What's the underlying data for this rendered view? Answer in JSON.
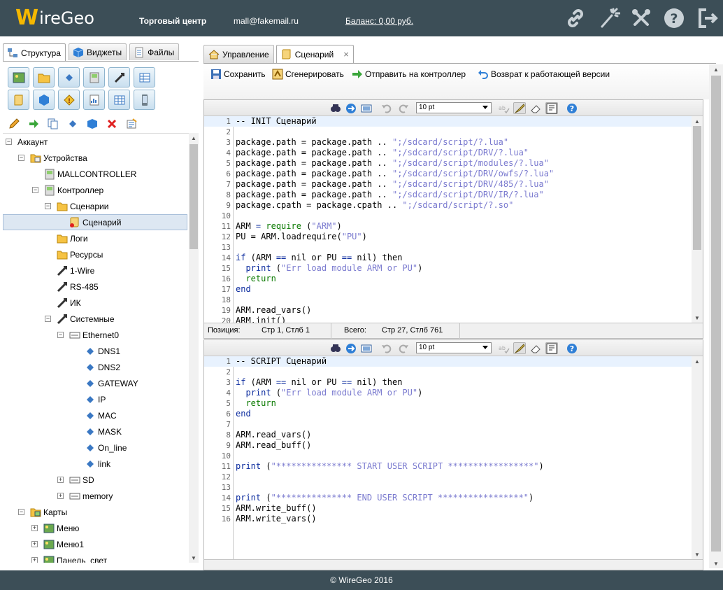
{
  "header": {
    "logo_w": "W",
    "logo_text": "ireGeo",
    "mall": "Торговый центр",
    "email": "mall@fakemail.ru",
    "balance": "Баланс: 0,00 руб.",
    "icons": [
      "link-icon",
      "magic-wand-icon",
      "tools-icon",
      "help-icon",
      "logout-icon"
    ]
  },
  "left_tabs": [
    {
      "label": "Структура",
      "icon": "structure-icon",
      "active": true
    },
    {
      "label": "Виджеты",
      "icon": "cube-icon",
      "active": false
    },
    {
      "label": "Файлы",
      "icon": "files-icon",
      "active": false
    }
  ],
  "tree": {
    "account": "Аккаунт",
    "devices": "Устройства",
    "mallcontroller": "MALLCONTROLLER",
    "controller": "Контроллер",
    "scenarios": "Сценарии",
    "scenario": "Сценарий",
    "logs": "Логи",
    "resources": "Ресурсы",
    "onewire": "1-Wire",
    "rs485": "RS-485",
    "ir": "ИК",
    "system": "Системные",
    "ethernet": "Ethernet0",
    "dns1": "DNS1",
    "dns2": "DNS2",
    "gateway": "GATEWAY",
    "ip": "IP",
    "mac": "MAC",
    "mask": "MASK",
    "online": "On_line",
    "link": "link",
    "sd": "SD",
    "memory": "memory",
    "maps": "Карты",
    "menu": "Меню",
    "menu1": "Меню1",
    "panel": "Панель_свет"
  },
  "right_tabs": [
    {
      "label": "Управление",
      "icon": "home-icon",
      "active": false
    },
    {
      "label": "Сценарий",
      "icon": "scroll-icon",
      "active": true,
      "close": "×"
    }
  ],
  "actions": {
    "save": "Сохранить",
    "generate": "Сгенерировать",
    "send": "Отправить на контроллер",
    "revert": "Возврат к работающей версии"
  },
  "font_size": "10 pt",
  "editor1": {
    "lines": [
      [
        [
          "c",
          "-- INIT Сценарий"
        ]
      ],
      [],
      [
        [
          "t",
          "package.path = package.path .. "
        ],
        [
          "s",
          "\";/sdcard/script/?.lua\""
        ]
      ],
      [
        [
          "t",
          "package.path = package.path .. "
        ],
        [
          "s",
          "\";/sdcard/script/DRV/?.lua\""
        ]
      ],
      [
        [
          "t",
          "package.path = package.path .. "
        ],
        [
          "s",
          "\";/sdcard/script/modules/?.lua\""
        ]
      ],
      [
        [
          "t",
          "package.path = package.path .. "
        ],
        [
          "s",
          "\";/sdcard/script/DRV/owfs/?.lua\""
        ]
      ],
      [
        [
          "t",
          "package.path = package.path .. "
        ],
        [
          "s",
          "\";/sdcard/script/DRV/485/?.lua\""
        ]
      ],
      [
        [
          "t",
          "package.path = package.path .. "
        ],
        [
          "s",
          "\";/sdcard/script/DRV/IR/?.lua\""
        ]
      ],
      [
        [
          "t",
          "package.cpath = package.cpath .. "
        ],
        [
          "s",
          "\";/sdcard/script/?.so\""
        ]
      ],
      [],
      [
        [
          "t",
          "ARM "
        ],
        [
          "o",
          "="
        ],
        [
          "t",
          " "
        ],
        [
          "g",
          "require"
        ],
        [
          "t",
          " ("
        ],
        [
          "s",
          "\"ARM\""
        ],
        [
          "t",
          ")"
        ]
      ],
      [
        [
          "t",
          "PU = ARM.loadrequire("
        ],
        [
          "s",
          "\"PU\""
        ],
        [
          "t",
          ")"
        ]
      ],
      [],
      [
        [
          "k",
          "if"
        ],
        [
          "t",
          " (ARM "
        ],
        [
          "o",
          "=="
        ],
        [
          "t",
          " nil or PU "
        ],
        [
          "o",
          "=="
        ],
        [
          "t",
          " nil) then"
        ]
      ],
      [
        [
          "t",
          "  "
        ],
        [
          "k",
          "print"
        ],
        [
          "t",
          " ("
        ],
        [
          "s",
          "\"Err load module ARM or PU\""
        ],
        [
          "t",
          ")"
        ]
      ],
      [
        [
          "t",
          "  "
        ],
        [
          "g",
          "return"
        ]
      ],
      [
        [
          "k",
          "end"
        ]
      ],
      [],
      [
        [
          "t",
          "ARM.read_vars()"
        ]
      ],
      [
        [
          "t",
          "ARM.init()"
        ]
      ]
    ],
    "status_pos_label": "Позиция:",
    "status_pos": "Стр 1, Стлб 1",
    "status_total_label": "Всего:",
    "status_total": "Стр 27, Стлб 761"
  },
  "editor2": {
    "lines": [
      [
        [
          "c",
          "-- SCRIPT Сценарий"
        ]
      ],
      [],
      [
        [
          "k",
          "if"
        ],
        [
          "t",
          " (ARM "
        ],
        [
          "o",
          "=="
        ],
        [
          "t",
          " nil or PU "
        ],
        [
          "o",
          "=="
        ],
        [
          "t",
          " nil) then"
        ]
      ],
      [
        [
          "t",
          "  "
        ],
        [
          "k",
          "print"
        ],
        [
          "t",
          " ("
        ],
        [
          "s",
          "\"Err load module ARM or PU\""
        ],
        [
          "t",
          ")"
        ]
      ],
      [
        [
          "t",
          "  "
        ],
        [
          "g",
          "return"
        ]
      ],
      [
        [
          "k",
          "end"
        ]
      ],
      [],
      [
        [
          "t",
          "ARM.read_vars()"
        ]
      ],
      [
        [
          "t",
          "ARM.read_buff()"
        ]
      ],
      [],
      [
        [
          "k",
          "print"
        ],
        [
          "t",
          " ("
        ],
        [
          "s",
          "\"*************** START USER SCRIPT *****************\""
        ],
        [
          "t",
          ")"
        ]
      ],
      [],
      [],
      [
        [
          "k",
          "print"
        ],
        [
          "t",
          " ("
        ],
        [
          "s",
          "\"*************** END USER SCRIPT *****************\""
        ],
        [
          "t",
          ")"
        ]
      ],
      [
        [
          "t",
          "ARM.write_buff()"
        ]
      ],
      [
        [
          "t",
          "ARM.write_vars()"
        ]
      ]
    ]
  },
  "footer": "© WireGeo 2016"
}
